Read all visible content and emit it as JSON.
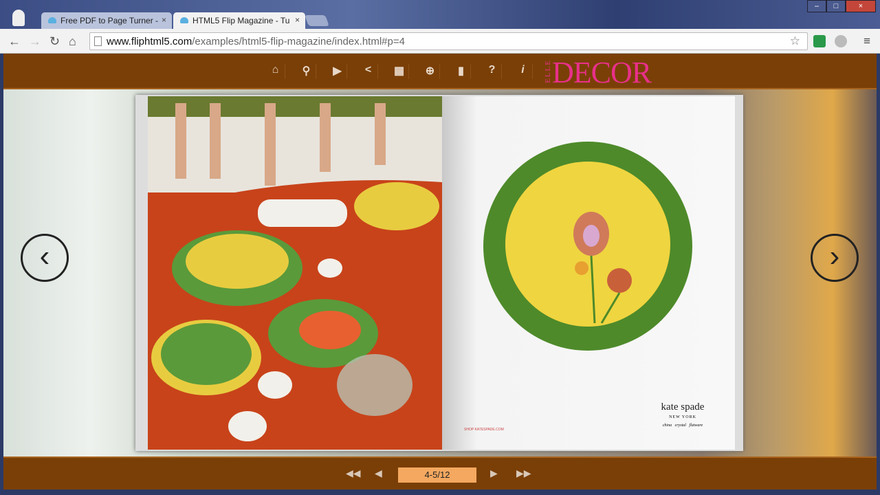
{
  "browser": {
    "tabs": [
      {
        "title": "Free PDF to Page Turner -",
        "close": "×"
      },
      {
        "title": "HTML5 Flip Magazine - Tu",
        "close": "×"
      }
    ],
    "url": {
      "domain": "www.fliphtml5.com",
      "path": "/examples/html5-flip-magazine/index.html#p=4"
    },
    "window_controls": [
      "–",
      "□",
      "×"
    ]
  },
  "viewer": {
    "toolbar": [
      {
        "icon": "home-icon",
        "glyph": "⌂"
      },
      {
        "icon": "search-icon",
        "glyph": "⚲"
      },
      {
        "icon": "autoplay-icon",
        "glyph": "▶"
      },
      {
        "icon": "share-icon",
        "glyph": "<"
      },
      {
        "icon": "thumbnails-icon",
        "glyph": "▦"
      },
      {
        "icon": "zoom-in-icon",
        "glyph": "⊕"
      },
      {
        "icon": "bookmark-icon",
        "glyph": "▮"
      },
      {
        "icon": "help-icon",
        "glyph": "?"
      },
      {
        "icon": "info-icon",
        "glyph": "i"
      }
    ],
    "logo": {
      "elle": "ELLE",
      "decor": "DECOR"
    },
    "ad": {
      "brand": "kate spade",
      "city": "NEW YORK",
      "products": "china   crystal   flatware",
      "url": "SHOP KATESPADE.COM"
    },
    "prev_arrow": "‹",
    "next_arrow": "›",
    "pager": {
      "first": "◀◀",
      "prev": "◀",
      "page": "4-5/12",
      "next": "▶",
      "last": "▶▶"
    },
    "colors": {
      "bar": "#7a3f06",
      "logo": "#e8308a",
      "page_field": "#f4a860"
    }
  }
}
